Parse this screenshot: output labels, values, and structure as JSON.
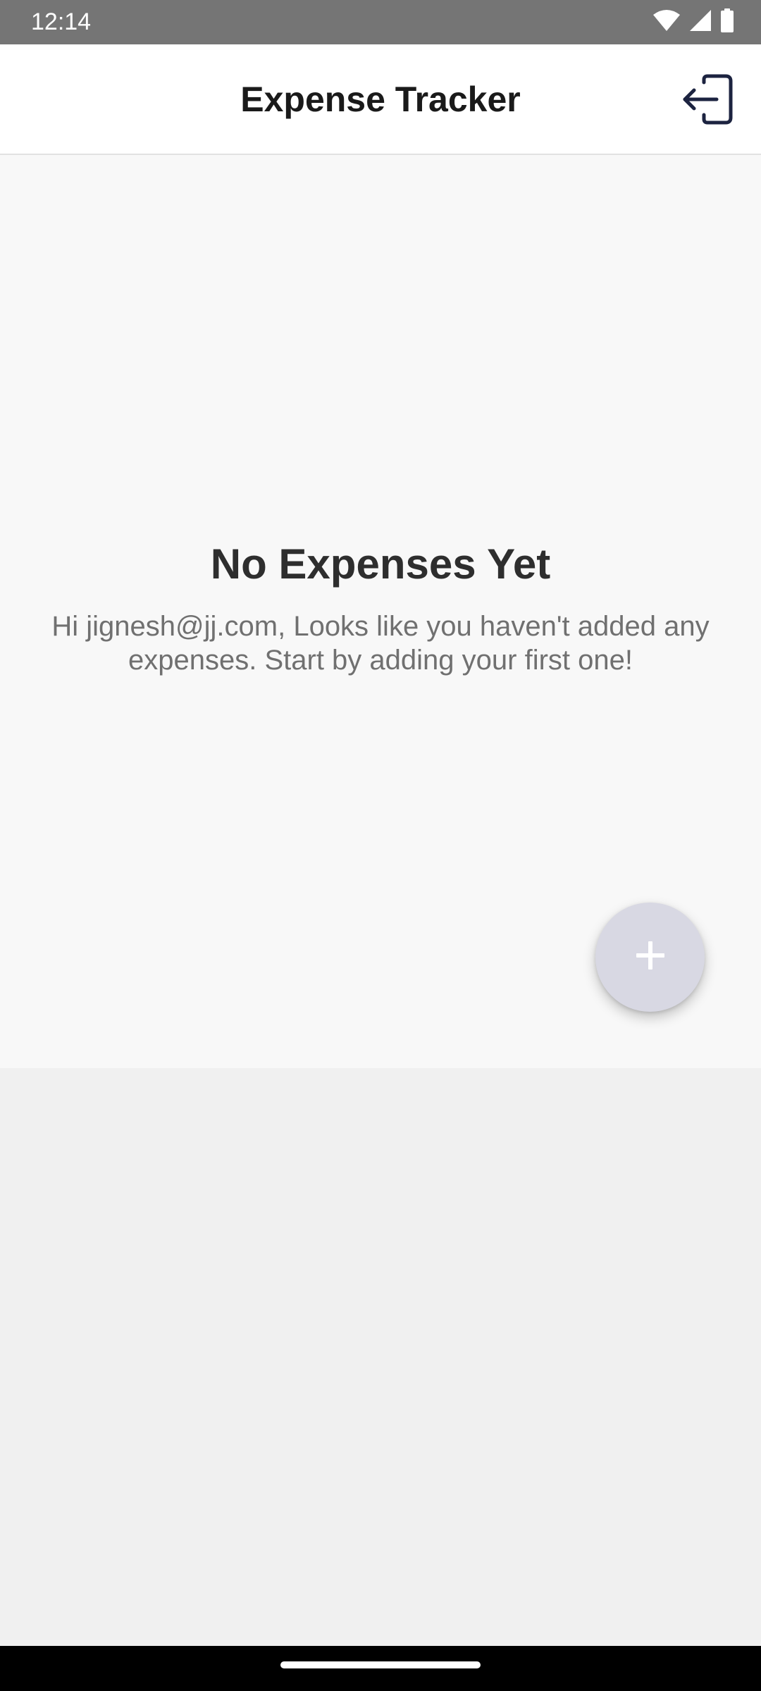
{
  "status_bar": {
    "time": "12:14",
    "icons": [
      "wifi-icon",
      "cellular-signal-icon",
      "battery-icon"
    ]
  },
  "header": {
    "title": "Expense Tracker",
    "logout_icon": "logout-icon"
  },
  "empty_state": {
    "title": "No Expenses Yet",
    "message": "Hi jignesh@jj.com, Looks like you haven't added any expenses. Start by adding your first one!"
  },
  "fab": {
    "icon": "plus-icon"
  },
  "colors": {
    "status_bar": "#757575",
    "header_bg": "#ffffff",
    "content_bg": "#f8f8f8",
    "page_bg": "#f0f0f0",
    "fab_bg": "#d8d8e3",
    "icon_dark": "#1c2340",
    "nav_bar": "#000000"
  }
}
